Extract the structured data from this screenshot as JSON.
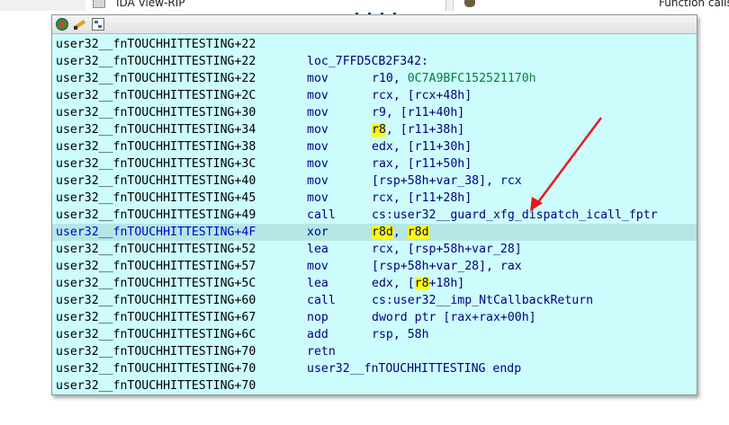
{
  "top_tabs": {
    "ida_view": {
      "title": "IDA View-RIP",
      "close_icon": "close-icon"
    },
    "function_calls": {
      "title": "Function calls: us"
    }
  },
  "popup": {
    "toolbar": {
      "sync_icon": "sync-icon",
      "edit_icon": "edit-icon",
      "graph_icon": "graph-icon"
    },
    "highlight_color": "#ffff00",
    "current_line_color": "#b6e6e6",
    "background_color": "#cdfcfc",
    "rows": [
      {
        "addr": "user32__fnTOUCHHITTESTING+22"
      },
      {
        "addr": "user32__fnTOUCHHITTESTING+22",
        "label": "loc_7FFD5CB2F342:"
      },
      {
        "addr": "user32__fnTOUCHHITTESTING+22",
        "mnem": "mov",
        "ops": [
          {
            "t": "r10, "
          },
          {
            "t": "0C7A9BFC152521170h",
            "c": "num"
          }
        ]
      },
      {
        "addr": "user32__fnTOUCHHITTESTING+2C",
        "mnem": "mov",
        "ops": [
          {
            "t": "rcx, [rcx+48h]"
          }
        ]
      },
      {
        "addr": "user32__fnTOUCHHITTESTING+30",
        "mnem": "mov",
        "ops": [
          {
            "t": "r9, [r11+40h]"
          }
        ]
      },
      {
        "addr": "user32__fnTOUCHHITTESTING+34",
        "mnem": "mov",
        "ops": [
          {
            "t": "r8",
            "c": "hl"
          },
          {
            "t": ", [r11+38h]"
          }
        ]
      },
      {
        "addr": "user32__fnTOUCHHITTESTING+38",
        "mnem": "mov",
        "ops": [
          {
            "t": "edx, [r11+30h]"
          }
        ]
      },
      {
        "addr": "user32__fnTOUCHHITTESTING+3C",
        "mnem": "mov",
        "ops": [
          {
            "t": "rax, [r11+50h]"
          }
        ]
      },
      {
        "addr": "user32__fnTOUCHHITTESTING+40",
        "mnem": "mov",
        "ops": [
          {
            "t": "[rsp+58h+var_38], rcx"
          }
        ]
      },
      {
        "addr": "user32__fnTOUCHHITTESTING+45",
        "mnem": "mov",
        "ops": [
          {
            "t": "rcx, [r11+28h]"
          }
        ]
      },
      {
        "addr": "user32__fnTOUCHHITTESTING+49",
        "mnem": "call",
        "ops": [
          {
            "t": "cs:user32__guard_xfg_dispatch_icall_fptr"
          }
        ]
      },
      {
        "addr": "user32__fnTOUCHHITTESTING+4F",
        "mnem": "xor",
        "current": true,
        "ops": [
          {
            "t": "r8d",
            "c": "hl"
          },
          {
            "t": ", "
          },
          {
            "t": "r8d",
            "c": "hl"
          }
        ]
      },
      {
        "addr": "user32__fnTOUCHHITTESTING+52",
        "mnem": "lea",
        "ops": [
          {
            "t": "rcx, [rsp+58h+var_28]"
          }
        ]
      },
      {
        "addr": "user32__fnTOUCHHITTESTING+57",
        "mnem": "mov",
        "ops": [
          {
            "t": "[rsp+58h+var_28], rax"
          }
        ]
      },
      {
        "addr": "user32__fnTOUCHHITTESTING+5C",
        "mnem": "lea",
        "ops": [
          {
            "t": "edx, ["
          },
          {
            "t": "r8",
            "c": "hl"
          },
          {
            "t": "+18h]"
          }
        ]
      },
      {
        "addr": "user32__fnTOUCHHITTESTING+60",
        "mnem": "call",
        "ops": [
          {
            "t": "cs:user32__imp_NtCallbackReturn"
          }
        ]
      },
      {
        "addr": "user32__fnTOUCHHITTESTING+67",
        "mnem": "nop",
        "ops": [
          {
            "t": "dword ptr [rax+rax+00h]"
          }
        ]
      },
      {
        "addr": "user32__fnTOUCHHITTESTING+6C",
        "mnem": "add",
        "ops": [
          {
            "t": "rsp, 58h"
          }
        ]
      },
      {
        "addr": "user32__fnTOUCHHITTESTING+70",
        "mnem": "retn"
      },
      {
        "addr": "user32__fnTOUCHHITTESTING+70",
        "label": "user32__fnTOUCHHITTESTING endp"
      },
      {
        "addr": "user32__fnTOUCHHITTESTING+70"
      }
    ]
  },
  "annotation": {
    "arrow_color": "#e8191c"
  }
}
